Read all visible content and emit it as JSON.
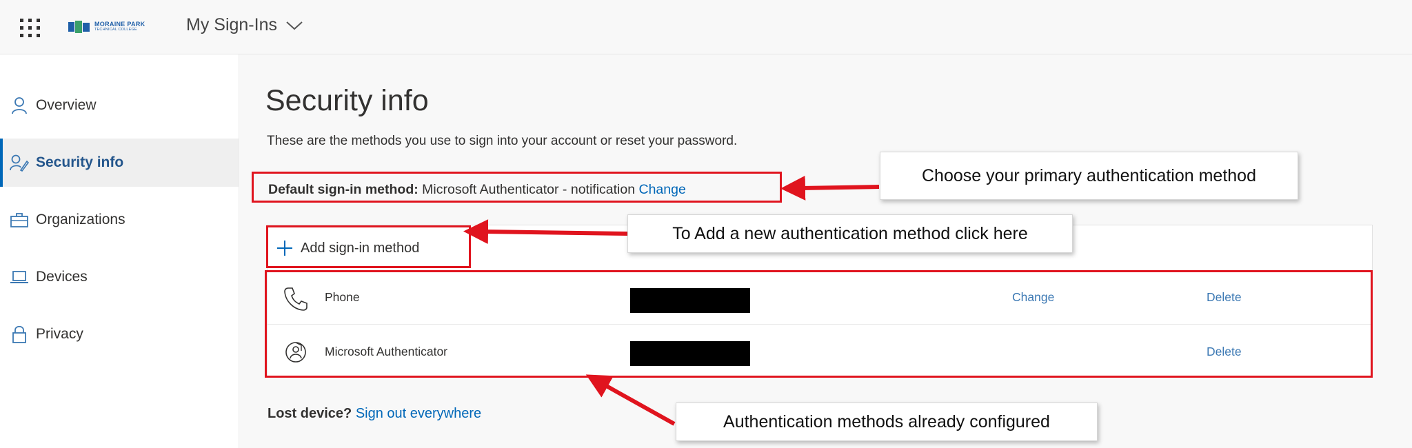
{
  "header": {
    "logo_line1": "MORAINE PARK",
    "logo_line2": "TECHNICAL COLLEGE",
    "app_title": "My Sign-Ins"
  },
  "sidebar": {
    "items": [
      {
        "label": "Overview",
        "icon": "person-icon"
      },
      {
        "label": "Security info",
        "icon": "security-info-icon",
        "active": true
      },
      {
        "label": "Organizations",
        "icon": "briefcase-icon"
      },
      {
        "label": "Devices",
        "icon": "laptop-icon"
      },
      {
        "label": "Privacy",
        "icon": "lock-icon"
      }
    ]
  },
  "main": {
    "title": "Security info",
    "description": "These are the methods you use to sign into your account or reset your password.",
    "default_method": {
      "label": "Default sign-in method:",
      "value": "Microsoft Authenticator - notification",
      "change_link": "Change"
    },
    "add_method_label": "Add sign-in method",
    "methods": [
      {
        "name": "Phone",
        "icon": "phone-icon",
        "detail": "[redacted]",
        "change": "Change",
        "delete": "Delete"
      },
      {
        "name": "Microsoft Authenticator",
        "icon": "authenticator-icon",
        "detail": "[redacted]",
        "delete": "Delete"
      }
    ],
    "lost_device": {
      "label": "Lost device?",
      "link": "Sign out everywhere"
    }
  },
  "annotations": {
    "primary_method": "Choose your primary authentication method",
    "add_method": "To Add a new authentication method click here",
    "configured": "Authentication methods already configured"
  },
  "colors": {
    "accent": "#0067b8",
    "annotation_red": "#e0141e",
    "link": "#3b78b3"
  }
}
